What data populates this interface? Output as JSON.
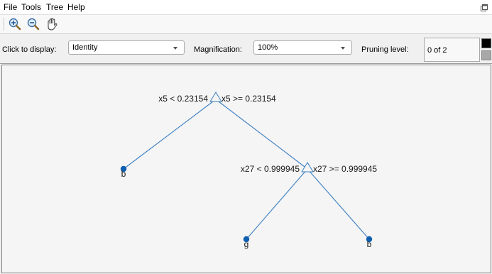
{
  "menu": {
    "file": "File",
    "tools": "Tools",
    "tree": "Tree",
    "help": "Help"
  },
  "toolbar": {
    "zoom_in": "zoom-in-icon",
    "zoom_out": "zoom-out-icon",
    "pan": "pan-hand-icon"
  },
  "controls": {
    "display_label": "Click to display:",
    "display_value": "Identity",
    "magnification_label": "Magnification:",
    "magnification_value": "100%",
    "pruning_label": "Pruning level:",
    "pruning_value": "0 of 2"
  },
  "tree": {
    "root": {
      "left_rule": "x5 < 0.23154",
      "right_rule": "x5 >= 0.23154"
    },
    "split": {
      "left_rule": "x27 < 0.999945",
      "right_rule": "x27 >= 0.999945"
    },
    "leaves": [
      "b",
      "g",
      "b"
    ],
    "colors": {
      "edge": "#3c7fc1",
      "leaf": "#0f5fb0"
    }
  }
}
